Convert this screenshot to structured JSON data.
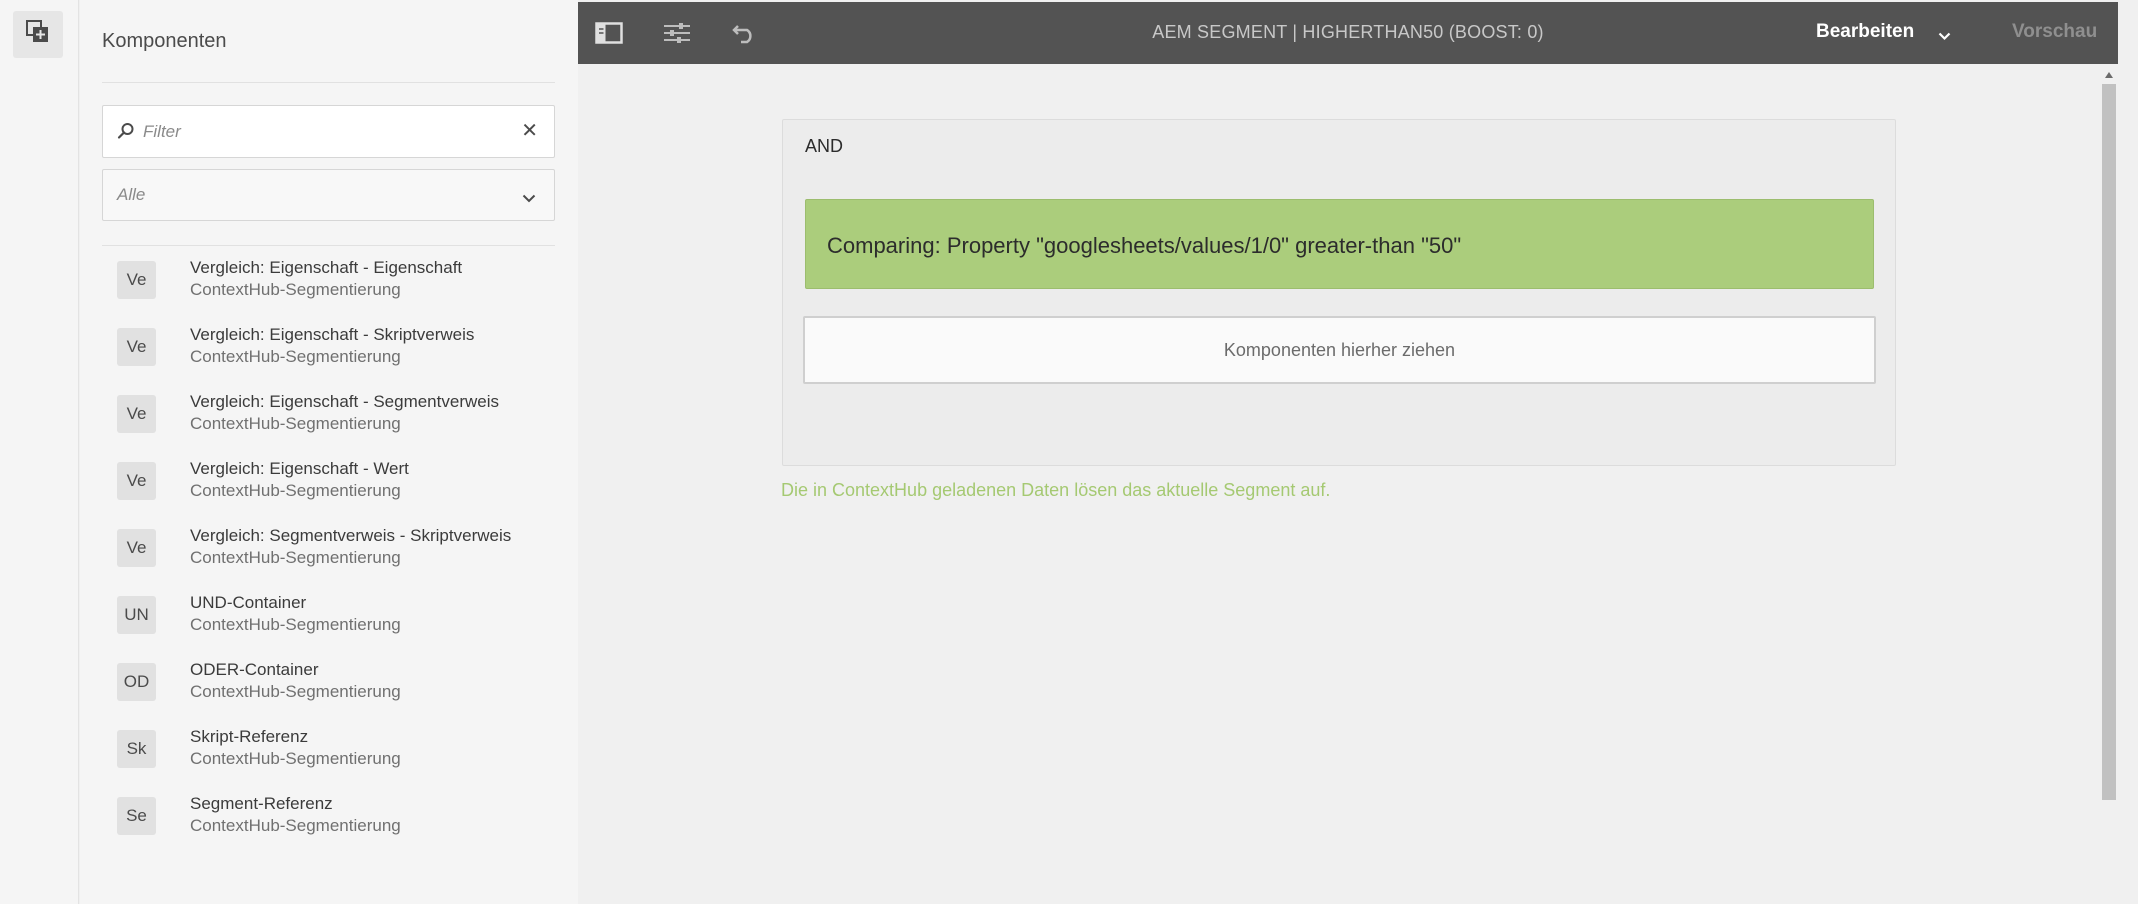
{
  "left_rail": {
    "toggle_icon": "components-panel-icon"
  },
  "panel": {
    "title": "Komponenten",
    "filter": {
      "placeholder": "Filter",
      "value": "",
      "search_icon": "search-icon",
      "clear_icon": "close-icon"
    },
    "group_select": {
      "value": "Alle",
      "chevron_icon": "chevron-down-icon"
    },
    "components": [
      {
        "badge": "Ve",
        "title": "Vergleich: Eigenschaft - Eigenschaft",
        "subtitle": "ContextHub-Segmentierung"
      },
      {
        "badge": "Ve",
        "title": "Vergleich: Eigenschaft - Skriptverweis",
        "subtitle": "ContextHub-Segmentierung"
      },
      {
        "badge": "Ve",
        "title": "Vergleich: Eigenschaft - Segmentverweis",
        "subtitle": "ContextHub-Segmentierung"
      },
      {
        "badge": "Ve",
        "title": "Vergleich: Eigenschaft - Wert",
        "subtitle": "ContextHub-Segmentierung"
      },
      {
        "badge": "Ve",
        "title": "Vergleich: Segmentverweis - Skriptverweis",
        "subtitle": "ContextHub-Segmentierung"
      },
      {
        "badge": "UN",
        "title": "UND-Container",
        "subtitle": "ContextHub-Segmentierung"
      },
      {
        "badge": "OD",
        "title": "ODER-Container",
        "subtitle": "ContextHub-Segmentierung"
      },
      {
        "badge": "Sk",
        "title": "Skript-Referenz",
        "subtitle": "ContextHub-Segmentierung"
      },
      {
        "badge": "Se",
        "title": "Segment-Referenz",
        "subtitle": "ContextHub-Segmentierung"
      }
    ]
  },
  "toolbar": {
    "icons": [
      "side-panel-icon",
      "page-properties-icon",
      "undo-icon"
    ],
    "title": "AEM SEGMENT | HIGHERTHAN50 (BOOST: 0)",
    "mode_label": "Bearbeiten",
    "preview_label": "Vorschau",
    "colors": {
      "background": "#535353",
      "title": "#c8c8c8"
    }
  },
  "canvas": {
    "container_label": "AND",
    "condition_text": "Comparing: Property \"googlesheets/values/1/0\" greater-than \"50\"",
    "dropzone_text": "Komponenten hierher ziehen",
    "status_text": "Die in ContextHub geladenen Daten lösen das aktuelle Segment auf.",
    "colors": {
      "condition": "#abcd7c",
      "status": "#a5c972"
    }
  }
}
